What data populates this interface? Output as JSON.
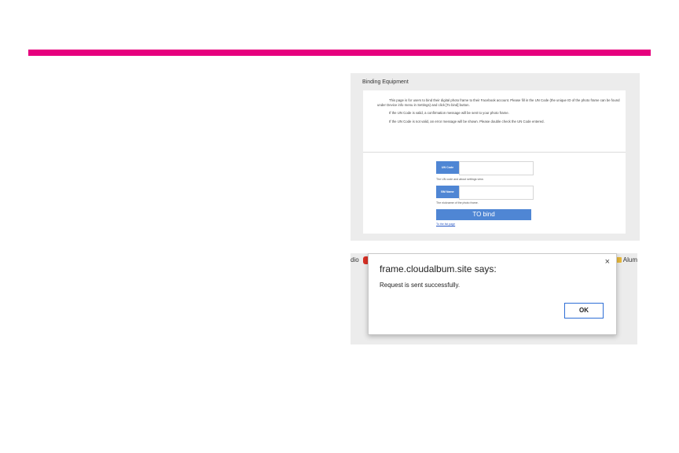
{
  "colors": {
    "accent": "#e6007e",
    "field_label_bg": "#4f86d4",
    "button_bg": "#4f86d4"
  },
  "screenshot1": {
    "title": "Binding Equipment",
    "description": [
      "This page is for users to bind their digital photo frame to their Facebook account. Please fill in the UN Code (the unique ID of the photo frame can be found under Device info menu in Settings) and click [To bind] button.",
      "If the UN Code is valid, a confirmation message will be sent to your photo frame.",
      "If the UN Code is not valid, an error message will be shown. Please double check the UN Code entered."
    ],
    "un_code": {
      "label": "UN Code",
      "value": "",
      "help": "The UN code and about settings view."
    },
    "bm_name": {
      "label": "BM Name",
      "value": "",
      "help": "The nickname of the photo frame."
    },
    "bind_button": "TO bind",
    "link_text": "To the list page"
  },
  "screenshot2": {
    "toolbar_left": "dio",
    "toolbar_right": "Alum",
    "dialog": {
      "title": "frame.cloudalbum.site says:",
      "message": "Request is sent successfully.",
      "ok_label": "OK",
      "close_icon": "close-icon"
    }
  }
}
